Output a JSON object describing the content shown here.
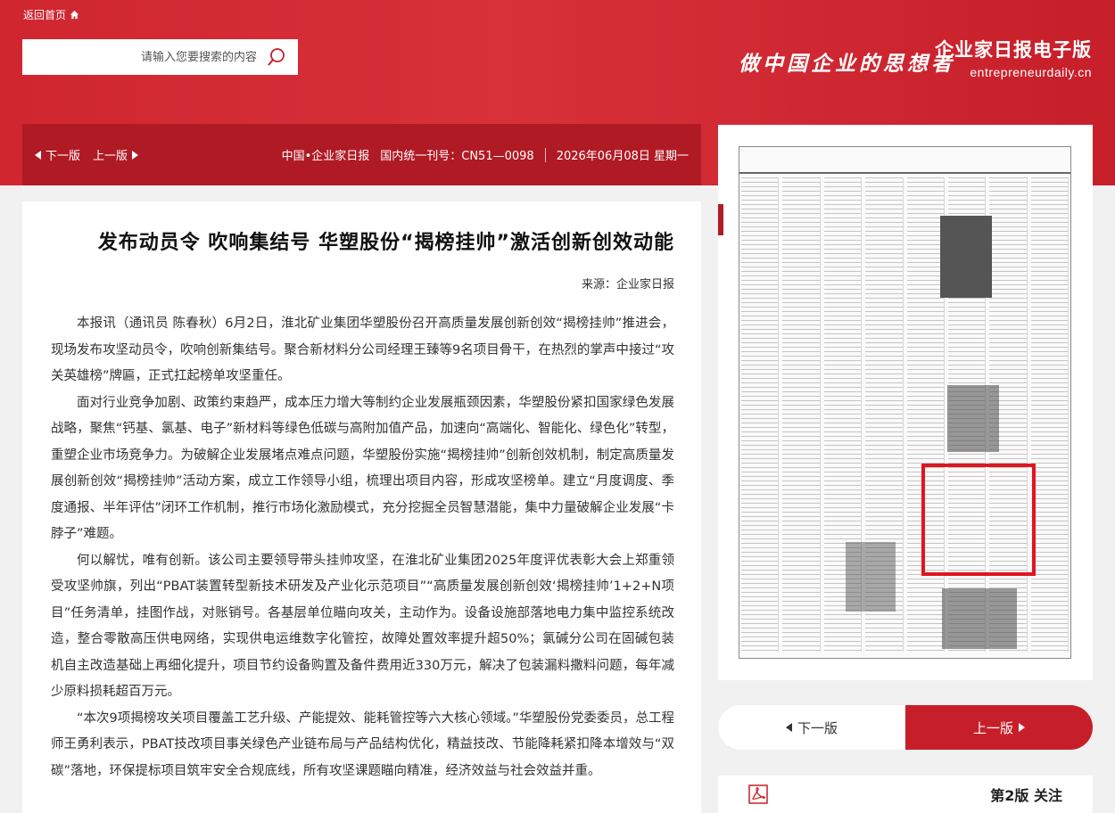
{
  "header": {
    "home_link": "返回首页",
    "search_placeholder": "请输入您要搜索的内容",
    "brand_cn": "企业家日报电子版",
    "brand_en": "entrepreneurdaily.cn",
    "slogan": "做中国企业的思想者"
  },
  "navbar": {
    "prev_label": "上一版",
    "next_label": "下一版",
    "date": "2026年06月08日 星期一",
    "issn": "国内统一刊号：CN51—0098",
    "paper_name": "中国•企业家日报"
  },
  "article": {
    "title": "发布动员令 吹响集结号 华塑股份“揭榜挂帅”激活创新创效动能",
    "source": "来源：企业家日报",
    "paragraphs": [
      "本报讯（通讯员 陈春秋）6月2日，淮北矿业集团华塑股份召开高质量发展创新创效“揭榜挂帅”推进会，现场发布攻坚动员令，吹响创新集结号。聚合新材料分公司经理王臻等9名项目骨干，在热烈的掌声中接过“攻关英雄榜”牌匾，正式扛起榜单攻坚重任。",
      "面对行业竞争加剧、政策约束趋严，成本压力增大等制约企业发展瓶颈因素，华塑股份紧扣国家绿色发展战略，聚焦“钙基、氯基、电子”新材料等绿色低碳与高附加值产品，加速向“高端化、智能化、绿色化”转型，重塑企业市场竞争力。为破解企业发展堵点难点问题，华塑股份实施“揭榜挂帅”创新创效机制，制定高质量发展创新创效“揭榜挂帅”活动方案，成立工作领导小组，梳理出项目内容，形成攻坚榜单。建立“月度调度、季度通报、半年评估”闭环工作机制，推行市场化激励模式，充分挖掘全员智慧潜能，集中力量破解企业发展“卡脖子”难题。",
      "何以解忧，唯有创新。该公司主要领导带头挂帅攻坚，在淮北矿业集团2025年度评优表彰大会上郑重领受攻坚帅旗，列出“PBAT装置转型新技术研发及产业化示范项目”“高质量发展创新创效‘揭榜挂帅’1+2+N项目”任务清单，挂图作战，对账销号。各基层单位瞄向攻关，主动作为。设备设施部落地电力集中监控系统改造，整合零散高压供电网络，实现供电运维数字化管控，故障处置效率提升超50%；氯碱分公司在固碱包装机自主改造基础上再细化提升，项目节约设备购置及备件费用近330万元，解决了包装漏料撒料问题，每年减少原料损耗超百万元。",
      "“本次9项揭榜攻关项目覆盖工艺升级、产能提效、能耗管控等六大核心领域。”华塑股份党委委员，总工程师王勇利表示，PBAT技改项目事关绿色产业链布局与产品结构优化，精益技改、节能降耗紧扣降本增效与“双碳”落地，环保提标项目筑牢安全合规底线，所有攻坚课题瞄向精准，经济效益与社会效益并重。"
    ]
  },
  "sidebar": {
    "paper_thumb_alt": "第2版版面",
    "pager_prev": "上一版",
    "pager_next": "下一版",
    "edition_label": "第2版 关注"
  },
  "colors": {
    "brand_red": "#cf2630",
    "nav_red": "#b01a24",
    "highlight_red": "#e0151f"
  }
}
